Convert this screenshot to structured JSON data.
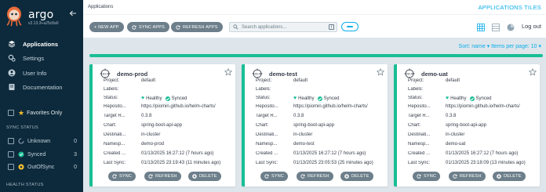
{
  "sidebar": {
    "brand": "argo",
    "version": "v2.13.3+a25c8a0",
    "nav": [
      {
        "label": "Applications",
        "icon": "layers-icon"
      },
      {
        "label": "Settings",
        "icon": "gears-icon"
      },
      {
        "label": "User Info",
        "icon": "user-icon"
      },
      {
        "label": "Documentation",
        "icon": "book-icon"
      }
    ],
    "favorites_label": "Favorites Only",
    "sync_status_title": "SYNC STATUS",
    "sync_filters": [
      {
        "label": "Unknown",
        "count": "0",
        "color": "#8fa4b1"
      },
      {
        "label": "Synced",
        "count": "3",
        "color": "#18be94"
      },
      {
        "label": "OutOfSync",
        "count": "0",
        "color": "#f4c030"
      }
    ],
    "health_status_title": "HEALTH STATUS"
  },
  "header": {
    "breadcrumb": "Applications",
    "view_title": "APPLICATIONS TILES",
    "logout": "Log out"
  },
  "toolbar": {
    "new_app": "+ NEW APP",
    "sync_apps": "SYNC APPS",
    "refresh_apps": "REFRESH APPS",
    "search_placeholder": "Search applications...",
    "search_shortcut": "/"
  },
  "sort": {
    "text": "Sort: name ▾ Items per page: 10 ▾"
  },
  "labels": {
    "project": "Project:",
    "labels": "Labels:",
    "status": "Status:",
    "repository": "Reposito...",
    "target": "Target R...",
    "chart": "Chart:",
    "destination": "Destinati...",
    "namespace": "Namesp...",
    "created": "Created ...",
    "last_sync": "Last Sync:",
    "healthy": "Healthy",
    "synced": "Synced",
    "sync_btn": "SYNC",
    "refresh_btn": "REFRESH",
    "delete_btn": "DELETE"
  },
  "apps": [
    {
      "name": "demo-prod",
      "project": "default",
      "labels": "",
      "repository": "https://piomin.github.io/helm-charts/",
      "target_revision": "0.3.8",
      "chart": "spring-boot-api-app",
      "destination": "in-cluster",
      "namespace": "demo-prod",
      "created": "01/13/2025 16:27:12  (7 hours ago)",
      "last_sync": "01/13/2025 23:19:43  (11 minutes ago)"
    },
    {
      "name": "demo-test",
      "project": "default",
      "labels": "",
      "repository": "https://piomin.github.io/helm-charts/",
      "target_revision": "0.3.8",
      "chart": "spring-boot-api-app",
      "destination": "in-cluster",
      "namespace": "demo-test",
      "created": "01/13/2025 16:27:12  (7 hours ago)",
      "last_sync": "01/13/2025 23:05:53  (25 minutes ago)"
    },
    {
      "name": "demo-uat",
      "project": "default",
      "labels": "",
      "repository": "https://piomin.github.io/helm-charts/",
      "target_revision": "0.3.8",
      "chart": "spring-boot-api-app",
      "destination": "in-cluster",
      "namespace": "demo-uat",
      "created": "01/13/2025 16:27:12  (7 hours ago)",
      "last_sync": "01/13/2025 23:18:09  (13 minutes ago)"
    }
  ],
  "colors": {
    "sidebar_bg": "#0d2a3c",
    "accent": "#0dadea",
    "healthy": "#18be94",
    "button": "#6d7f8b"
  }
}
